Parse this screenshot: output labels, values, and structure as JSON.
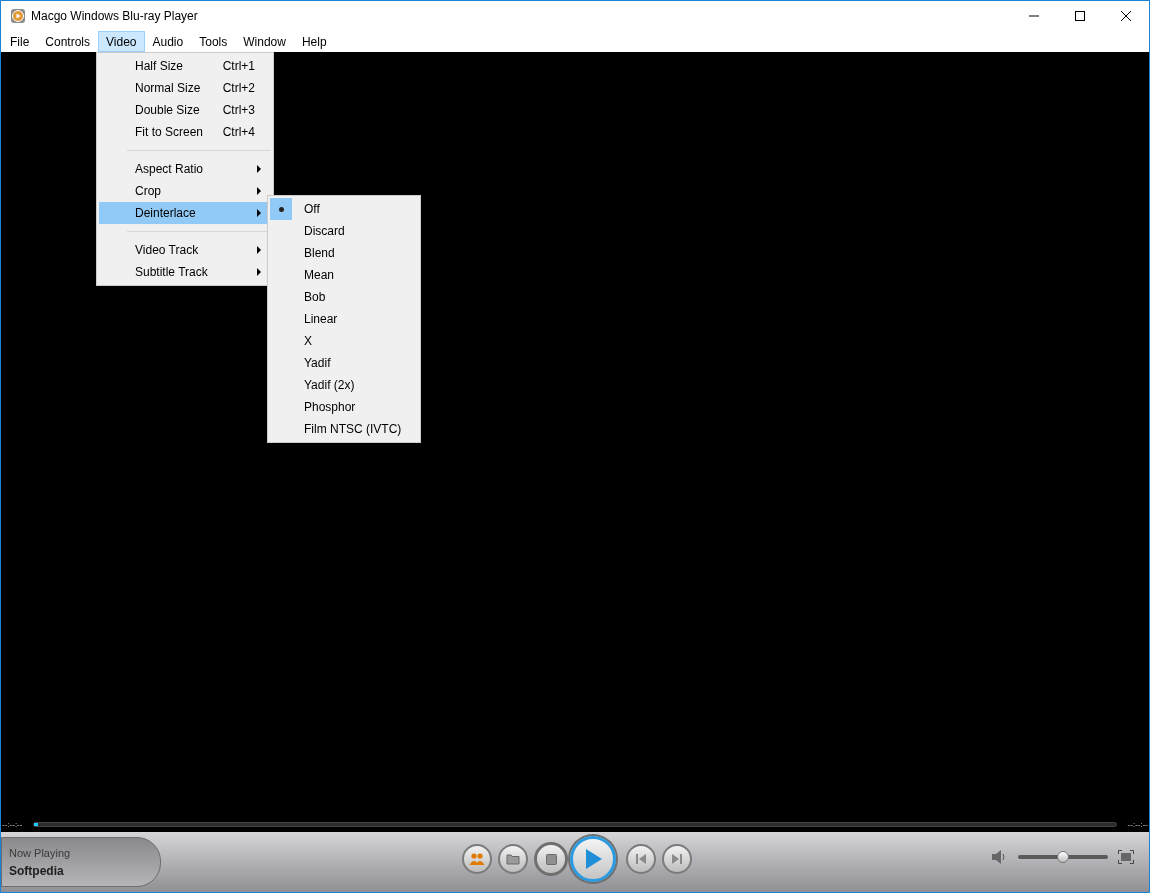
{
  "window": {
    "title": "Macgo Windows Blu-ray Player"
  },
  "menu_bar": [
    {
      "label": "File",
      "selected": false
    },
    {
      "label": "Controls",
      "selected": false
    },
    {
      "label": "Video",
      "selected": true
    },
    {
      "label": "Audio",
      "selected": false
    },
    {
      "label": "Tools",
      "selected": false
    },
    {
      "label": "Window",
      "selected": false
    },
    {
      "label": "Help",
      "selected": false
    }
  ],
  "video_menu": [
    {
      "kind": "item",
      "label": "Half Size",
      "shortcut": "Ctrl+1"
    },
    {
      "kind": "item",
      "label": "Normal Size",
      "shortcut": "Ctrl+2"
    },
    {
      "kind": "item",
      "label": "Double Size",
      "shortcut": "Ctrl+3"
    },
    {
      "kind": "item",
      "label": "Fit to Screen",
      "shortcut": "Ctrl+4"
    },
    {
      "kind": "separator"
    },
    {
      "kind": "submenu",
      "label": "Aspect Ratio",
      "selected": false
    },
    {
      "kind": "submenu",
      "label": "Crop",
      "selected": false
    },
    {
      "kind": "submenu",
      "label": "Deinterlace",
      "selected": true
    },
    {
      "kind": "separator"
    },
    {
      "kind": "submenu",
      "label": "Video Track",
      "selected": false
    },
    {
      "kind": "submenu",
      "label": "Subtitle Track",
      "selected": false
    }
  ],
  "deinterlace_menu": [
    {
      "label": "Off",
      "selected": true
    },
    {
      "label": "Discard",
      "selected": false
    },
    {
      "label": "Blend",
      "selected": false
    },
    {
      "label": "Mean",
      "selected": false
    },
    {
      "label": "Bob",
      "selected": false
    },
    {
      "label": "Linear",
      "selected": false
    },
    {
      "label": "X",
      "selected": false
    },
    {
      "label": "Yadif",
      "selected": false
    },
    {
      "label": "Yadif (2x)",
      "selected": false
    },
    {
      "label": "Phosphor",
      "selected": false
    },
    {
      "label": "Film NTSC (IVTC)",
      "selected": false
    }
  ],
  "seek_bar": {
    "elapsed": "--:--:--",
    "level": 0,
    "remaining": "--:--:--"
  },
  "now_playing": {
    "label": "Now Playing",
    "title": "Softpedia"
  },
  "volume": {
    "level": 0.5
  }
}
